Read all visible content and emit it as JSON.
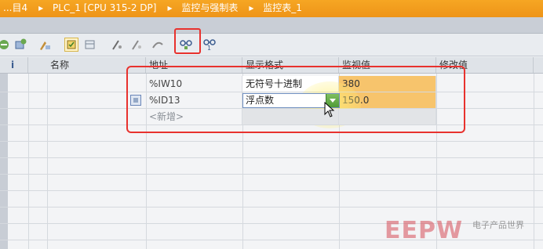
{
  "titlebar": {
    "crumbs": [
      "...目4",
      "PLC_1 [CPU 315-2 DP]",
      "监控与强制表",
      "监控表_1"
    ]
  },
  "table": {
    "headers": {
      "info": "i",
      "name": "名称",
      "address": "地址",
      "display_format": "显示格式",
      "monitor_value": "监视值",
      "modify_value": "修改值"
    },
    "rows": [
      {
        "address": "%IW10",
        "display_format": "无符号十进制",
        "monitor_value": "380"
      },
      {
        "address": "%ID13",
        "display_format": "浮点数",
        "monitor_value": "150.0"
      },
      {
        "address": "<新增>"
      }
    ]
  },
  "watermark": {
    "logo": "EEPW",
    "subtitle": "电子产品世界"
  },
  "colors": {
    "titlebar": "#f19a1c",
    "monitor_value_bg": "#f7c46c",
    "highlight_box": "#e8322e",
    "dropdown_button": "#5aa83e"
  }
}
